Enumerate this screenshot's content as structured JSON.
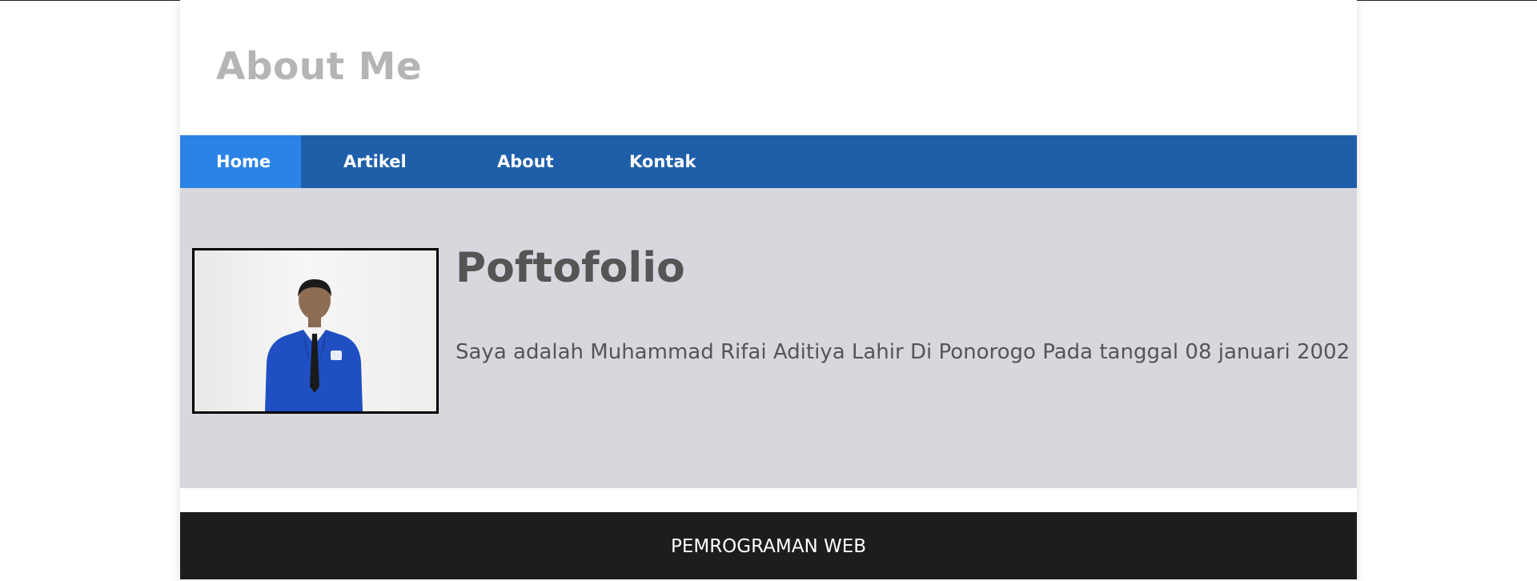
{
  "header": {
    "site_title": "About Me"
  },
  "nav": {
    "items": [
      {
        "label": "Home",
        "active": true
      },
      {
        "label": "Artikel",
        "active": false
      },
      {
        "label": "About",
        "active": false
      },
      {
        "label": "Kontak",
        "active": false
      }
    ]
  },
  "main": {
    "title": "Poftofolio",
    "description": "Saya adalah Muhammad Rifai Aditiya Lahir Di Ponorogo Pada tanggal 08 januari 2002"
  },
  "footer": {
    "text": "PEMROGRAMAN WEB"
  },
  "colors": {
    "title_gray": "#b5b5b5",
    "nav_blue": "#1f5faa",
    "nav_active": "#2b83e5",
    "content_bg": "#d8d7de",
    "footer_bg": "#1d1d1d"
  }
}
